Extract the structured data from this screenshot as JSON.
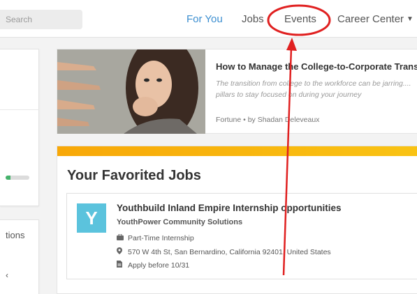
{
  "search": {
    "placeholder": "Search"
  },
  "nav": {
    "items": [
      {
        "label": "For You",
        "active": true
      },
      {
        "label": "Jobs",
        "active": false
      },
      {
        "label": "Events",
        "active": false
      },
      {
        "label": "Career Center",
        "active": false,
        "dropdown": true
      }
    ]
  },
  "left": {
    "profile_progress": 0.2,
    "section_label": "tions",
    "partial_text": "‹"
  },
  "article": {
    "title": "How to Manage the College-to-Corporate Transi",
    "description": "The transition from college to the workforce can be jarring.... pillars to stay focused on during your journey",
    "meta": "Fortune • by Shadan Deleveaux"
  },
  "favorites": {
    "heading": "Your Favorited Jobs",
    "jobs": [
      {
        "logo_letter": "Y",
        "title": "Youthbuild Inland Empire Internship opportunities",
        "company": "YouthPower Community Solutions",
        "type": "Part-Time Internship",
        "location": "570 W 4th St, San Bernardino, California 92401, United States",
        "deadline": "Apply before 10/31"
      }
    ]
  },
  "colors": {
    "accent": "#3b8ed0",
    "banner_start": "#f8a808",
    "banner_end": "#f9c314",
    "logo_bg": "#5bc3dd",
    "annotation": "#e02020",
    "progress": "#45b26b"
  },
  "icons": {
    "job_type": "briefcase-icon",
    "location": "map-pin-icon",
    "deadline": "document-icon"
  }
}
